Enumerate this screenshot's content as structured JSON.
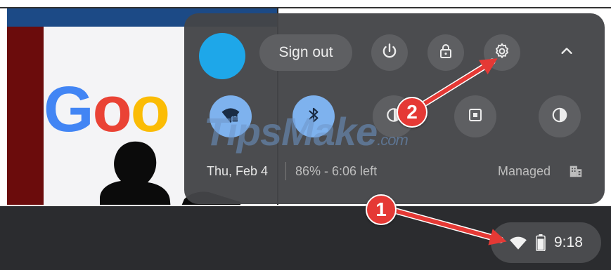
{
  "quick_settings": {
    "signout_label": "Sign out",
    "icons": {
      "power": "power-icon",
      "lock": "lock-icon",
      "settings": "gear-icon",
      "collapse": "chevron-up-icon",
      "network": "wifi-icon",
      "bluetooth": "bluetooth-icon",
      "night_light": "night-light-icon",
      "screen_capture": "screen-capture-icon",
      "dark_theme": "dark-theme-icon",
      "managed": "managed-building-icon"
    },
    "feature_pods": [
      {
        "name": "wifi",
        "active": true
      },
      {
        "name": "bluetooth",
        "active": true
      },
      {
        "name": "night-light",
        "active": false
      },
      {
        "name": "screen-capture",
        "active": false
      },
      {
        "name": "dark-theme",
        "active": false
      }
    ],
    "footer": {
      "date": "Thu, Feb 4",
      "battery": "86% - 6:06 left",
      "managed": "Managed"
    }
  },
  "shelf": {
    "time": "9:18",
    "battery_level": 0.86
  },
  "annotations": [
    {
      "label": "1",
      "color": "#e53935"
    },
    {
      "label": "2",
      "color": "#e53935"
    }
  ],
  "wallpaper": {
    "logo_letters": [
      "G",
      "o",
      "o"
    ]
  },
  "watermark": {
    "text": "TipsMake",
    "suffix": ".com"
  }
}
